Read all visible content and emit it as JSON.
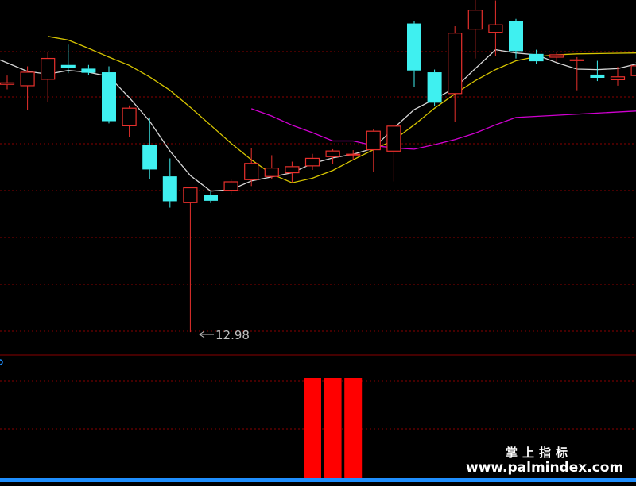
{
  "chart_data": [
    {
      "type": "candlestick",
      "panel": "price",
      "ylim": [
        12.5,
        20.5
      ],
      "grid": "dotted horizontal",
      "colors": {
        "up": "#e8302c",
        "down": "#3ff0f0",
        "ma_short": "#d6d6d6",
        "ma_mid": "#d6c400",
        "ma_long": "#d000d0",
        "grid": "#8a0000"
      },
      "candles": [
        {
          "o": 18.35,
          "h": 18.55,
          "l": 18.25,
          "c": 18.4
        },
        {
          "o": 18.32,
          "h": 18.75,
          "l": 17.8,
          "c": 18.63
        },
        {
          "o": 18.46,
          "h": 19.06,
          "l": 17.98,
          "c": 18.93
        },
        {
          "o": 18.78,
          "h": 19.22,
          "l": 18.6,
          "c": 18.71
        },
        {
          "o": 18.7,
          "h": 18.78,
          "l": 18.56,
          "c": 18.61
        },
        {
          "o": 18.62,
          "h": 18.75,
          "l": 17.51,
          "c": 17.56
        },
        {
          "o": 17.45,
          "h": 17.9,
          "l": 17.22,
          "c": 17.85
        },
        {
          "o": 17.05,
          "h": 17.64,
          "l": 16.3,
          "c": 16.51
        },
        {
          "o": 16.36,
          "h": 16.75,
          "l": 15.68,
          "c": 15.82
        },
        {
          "o": 15.78,
          "h": 16.0,
          "l": 12.98,
          "c": 16.12
        },
        {
          "o": 15.96,
          "h": 16.03,
          "l": 15.78,
          "c": 15.83
        },
        {
          "o": 16.05,
          "h": 16.3,
          "l": 15.95,
          "c": 16.25
        },
        {
          "o": 16.28,
          "h": 16.97,
          "l": 16.15,
          "c": 16.65
        },
        {
          "o": 16.35,
          "h": 16.82,
          "l": 16.3,
          "c": 16.55
        },
        {
          "o": 16.43,
          "h": 16.68,
          "l": 16.23,
          "c": 16.58
        },
        {
          "o": 16.58,
          "h": 16.85,
          "l": 16.5,
          "c": 16.76
        },
        {
          "o": 16.78,
          "h": 16.95,
          "l": 16.63,
          "c": 16.92
        },
        {
          "o": 16.83,
          "h": 16.93,
          "l": 16.72,
          "c": 16.85
        },
        {
          "o": 16.93,
          "h": 17.38,
          "l": 16.45,
          "c": 17.35
        },
        {
          "o": 16.9,
          "h": 17.42,
          "l": 16.25,
          "c": 17.46
        },
        {
          "o": 19.68,
          "h": 19.73,
          "l": 18.3,
          "c": 18.66
        },
        {
          "o": 18.62,
          "h": 18.68,
          "l": 17.88,
          "c": 17.96
        },
        {
          "o": 18.15,
          "h": 19.62,
          "l": 17.55,
          "c": 19.48
        },
        {
          "o": 19.55,
          "h": 20.38,
          "l": 18.92,
          "c": 19.98
        },
        {
          "o": 19.48,
          "h": 20.18,
          "l": 18.98,
          "c": 19.66
        },
        {
          "o": 19.73,
          "h": 19.78,
          "l": 18.92,
          "c": 19.08
        },
        {
          "o": 19.02,
          "h": 19.11,
          "l": 18.81,
          "c": 18.86
        },
        {
          "o": 18.94,
          "h": 19.07,
          "l": 18.85,
          "c": 19.01
        },
        {
          "o": 18.88,
          "h": 18.95,
          "l": 18.23,
          "c": 18.9
        },
        {
          "o": 18.57,
          "h": 18.87,
          "l": 18.43,
          "c": 18.5
        },
        {
          "o": 18.45,
          "h": 18.74,
          "l": 18.33,
          "c": 18.53
        },
        {
          "o": 18.54,
          "h": 18.82,
          "l": 18.14,
          "c": 18.77
        }
      ],
      "series": [
        {
          "type": "line",
          "values": [
            18.89,
            18.64,
            18.58,
            18.66,
            18.62,
            18.53,
            18.07,
            17.56,
            16.91,
            16.38,
            16.04,
            16.07,
            16.26,
            16.35,
            16.44,
            16.64,
            16.76,
            16.84,
            16.97,
            17.41,
            17.81,
            18.04,
            18.28,
            18.7,
            19.11,
            19.04,
            19.0,
            18.83,
            18.69,
            18.68,
            18.7,
            18.81
          ]
        },
        {
          "type": "line",
          "values": [
            null,
            19.4,
            19.32,
            19.14,
            18.95,
            18.77,
            18.52,
            18.23,
            17.86,
            17.47,
            17.08,
            16.72,
            16.41,
            16.22,
            16.32,
            16.49,
            16.72,
            16.94,
            17.15,
            17.48,
            17.84,
            18.15,
            18.44,
            18.68,
            18.87,
            18.96,
            19.0,
            19.02
          ]
        },
        {
          "type": "line",
          "values": [
            17.83,
            17.67,
            17.47,
            17.31,
            17.13,
            17.13,
            17.03,
            16.98,
            16.95,
            17.05,
            17.16,
            17.3,
            17.48,
            17.64
          ]
        }
      ],
      "annotations": [
        {
          "label": "12.98"
        }
      ]
    },
    {
      "type": "bar",
      "panel": "indicator",
      "colors": {
        "bar": "#ff0000",
        "baseline": "#1f8fff"
      },
      "values": [
        0,
        0,
        0,
        0,
        0,
        0,
        0,
        0,
        0,
        0,
        0,
        0,
        0,
        0,
        0,
        1,
        1,
        1,
        0,
        0,
        0,
        0,
        0,
        0,
        0,
        0,
        0,
        0,
        0,
        0,
        0,
        0
      ]
    }
  ],
  "watermark": {
    "cn": "掌上指标",
    "url": "www.palmindex.com"
  }
}
